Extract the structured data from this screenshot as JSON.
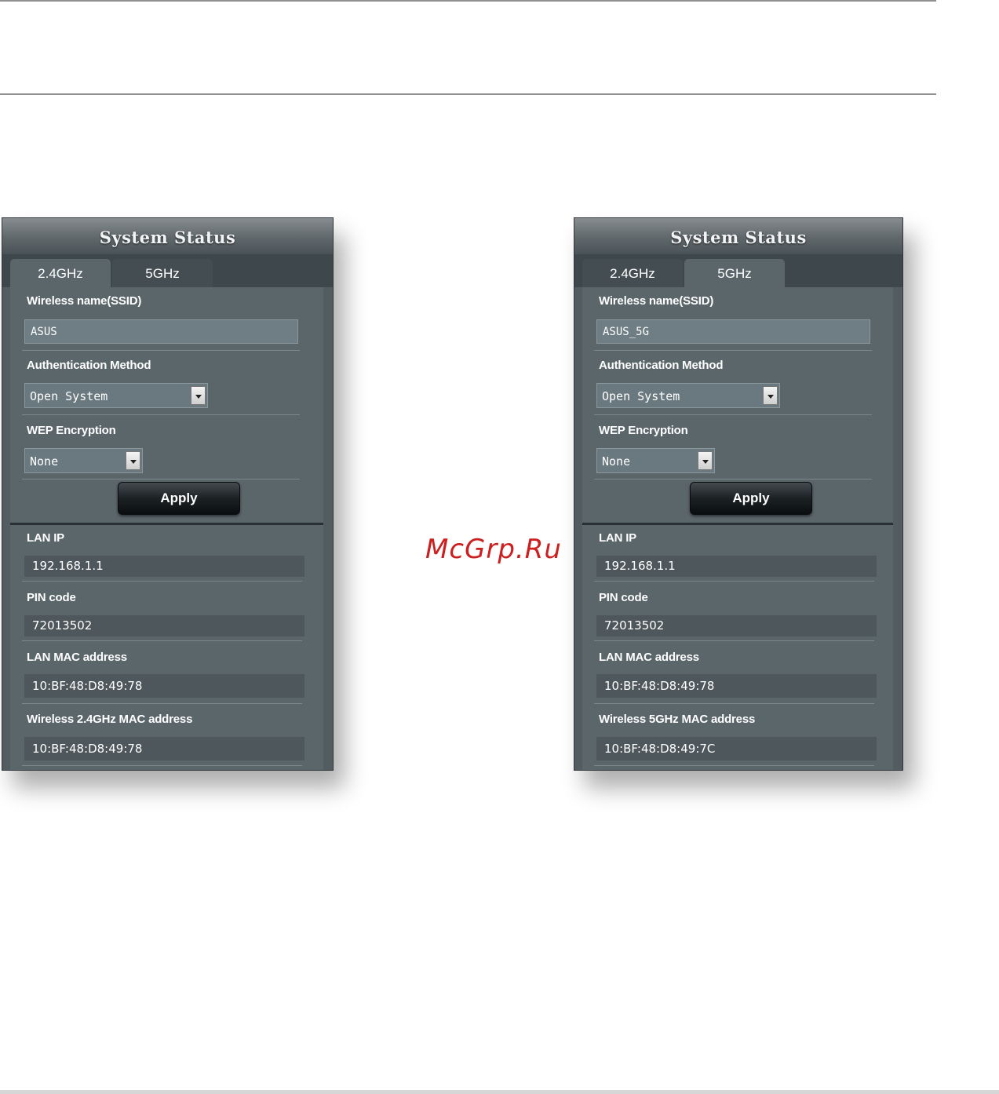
{
  "watermark": "McGrp.Ru",
  "panels": [
    {
      "title": "System Status",
      "tabs": [
        "2.4GHz",
        "5GHz"
      ],
      "active_tab": 0,
      "ssid_label": "Wireless name(SSID)",
      "ssid_value": "ASUS",
      "auth_label": "Authentication Method",
      "auth_value": "Open System",
      "wep_label": "WEP Encryption",
      "wep_value": "None",
      "apply_label": "Apply",
      "lan_ip_label": "LAN IP",
      "lan_ip_value": "192.168.1.1",
      "pin_label": "PIN code",
      "pin_value": "72013502",
      "lan_mac_label": "LAN MAC address",
      "lan_mac_value": "10:BF:48:D8:49:78",
      "wireless_mac_label": "Wireless 2.4GHz MAC address",
      "wireless_mac_value": "10:BF:48:D8:49:78"
    },
    {
      "title": "System Status",
      "tabs": [
        "2.4GHz",
        "5GHz"
      ],
      "active_tab": 1,
      "ssid_label": "Wireless name(SSID)",
      "ssid_value": "ASUS_5G",
      "auth_label": "Authentication Method",
      "auth_value": "Open System",
      "wep_label": "WEP Encryption",
      "wep_value": "None",
      "apply_label": "Apply",
      "lan_ip_label": "LAN IP",
      "lan_ip_value": "192.168.1.1",
      "pin_label": "PIN code",
      "pin_value": "72013502",
      "lan_mac_label": "LAN MAC address",
      "lan_mac_value": "10:BF:48:D8:49:78",
      "wireless_mac_label": "Wireless 5GHz MAC address",
      "wireless_mac_value": "10:BF:48:D8:49:7C"
    }
  ]
}
